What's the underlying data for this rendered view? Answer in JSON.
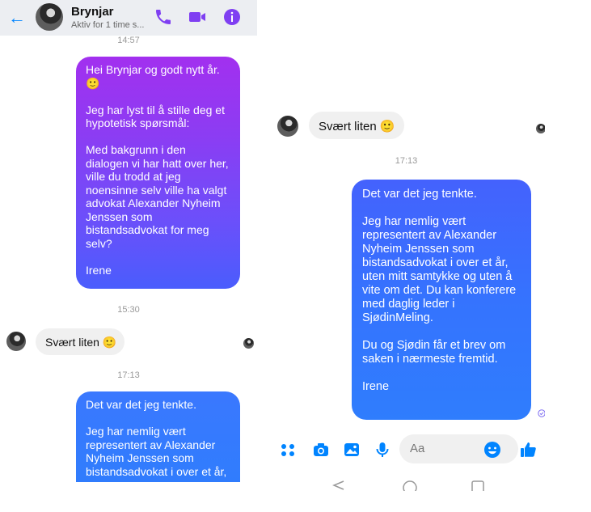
{
  "left": {
    "header": {
      "name": "Brynjar",
      "status": "Aktiv for 1 time s..."
    },
    "timestamps": {
      "top": "14:57",
      "t1530": "15:30",
      "t1713": "17:13"
    },
    "messages": {
      "m1": "Hei Brynjar og godt nytt år. 🙂\n\nJeg har lyst til å stille deg et hypotetisk spørsmål:\n\nMed bakgrunn i den dialogen vi har hatt over her, ville du trodd at jeg noensinne selv ville ha valgt advokat Alexander Nyheim Jenssen som bistandsadvokat for meg selv?\n\nIrene",
      "m2": "Svært liten 🙂",
      "m3": "Det var det jeg tenkte.\n\nJeg har nemlig vært representert av Alexander Nyheim Jenssen som bistandsadvokat i over et år,"
    }
  },
  "right": {
    "timestamps": {
      "t1713": "17:13"
    },
    "messages": {
      "m2": "Svært liten 🙂",
      "m3": "Det var det jeg tenkte.\n\nJeg har nemlig vært representert av Alexander Nyheim Jenssen som bistandsadvokat i over et år, uten mitt samtykke og uten å vite om det. Du kan konferere med daglig leder i SjødinMeling.\n\nDu og Sjødin får et brev om saken i nærmeste fremtid.\n\nIrene"
    },
    "composer": {
      "placeholder": "Aa"
    }
  },
  "colors": {
    "accent": "#0084ff",
    "bubble_purple": "#a230ef",
    "bubble_blue": "#2f7dfd",
    "incoming_bg": "#f0f0f0"
  },
  "icons": [
    "back-arrow-icon",
    "phone-icon",
    "video-camera-icon",
    "info-icon",
    "apps-grid-icon",
    "camera-icon",
    "gallery-icon",
    "microphone-icon",
    "emoji-icon",
    "thumbs-up-icon",
    "seen-check-icon"
  ]
}
